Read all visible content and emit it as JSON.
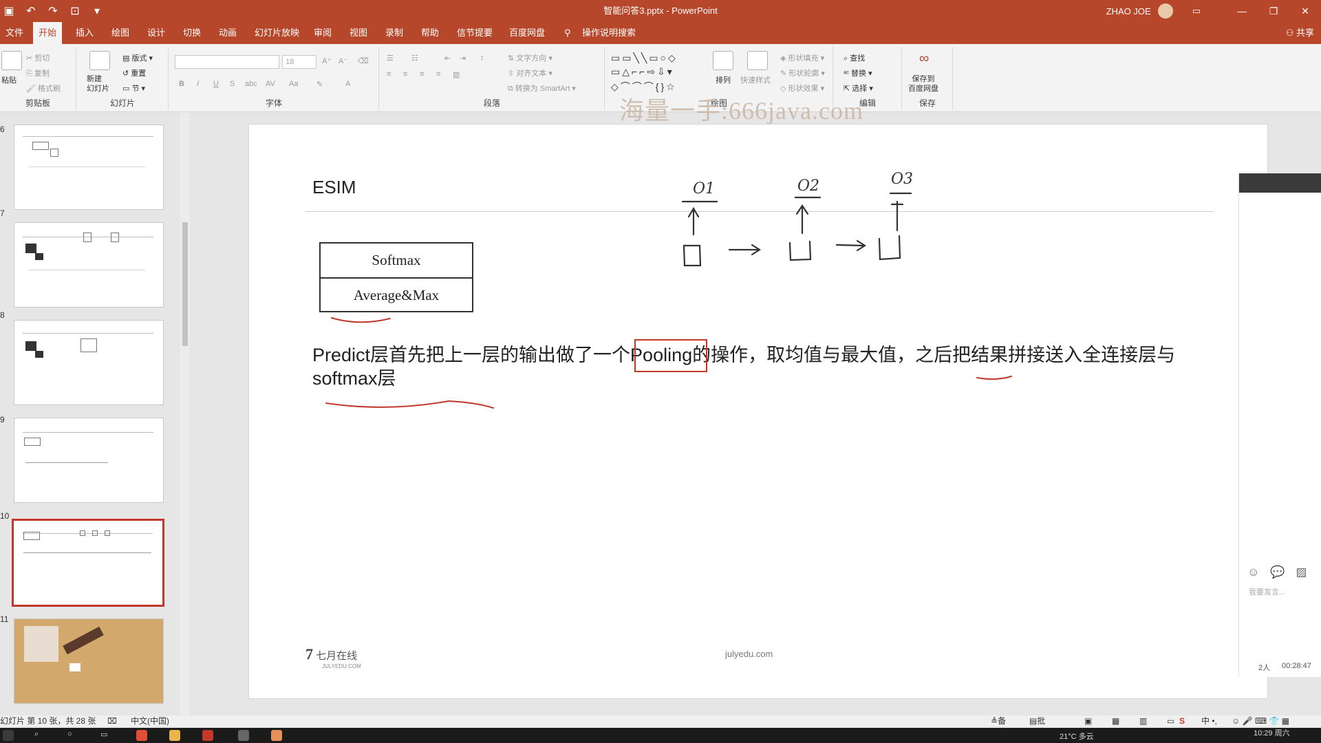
{
  "titlebar": {
    "title": "智能问答3.pptx - PowerPoint",
    "user": "ZHAO JOE"
  },
  "menu": {
    "tabs": [
      "文件",
      "开始",
      "插入",
      "绘图",
      "设计",
      "切换",
      "动画",
      "幻灯片放映",
      "审阅",
      "视图",
      "录制",
      "帮助",
      "信节提要",
      "百度网盘"
    ],
    "search": "操作说明搜索",
    "share": "共享"
  },
  "ribbon": {
    "clipboard": {
      "label": "剪贴板",
      "paste": "粘贴",
      "cut": "剪切",
      "copy": "复制",
      "format": "格式刷"
    },
    "slides": {
      "label": "幻灯片",
      "new": "新建\n幻灯片",
      "layout": "版式",
      "reset": "重置",
      "section": "节"
    },
    "font": {
      "label": "字体",
      "size": "18"
    },
    "paragraph": {
      "label": "段落",
      "text_dir": "文字方向",
      "align_text": "对齐文本",
      "smartart": "转换为 SmartArt"
    },
    "drawing": {
      "label": "绘图",
      "arrange": "排列",
      "quick_styles": "快速样式",
      "fill": "形状填充",
      "outline": "形状轮廓",
      "effects": "形状效果"
    },
    "editing": {
      "label": "编辑",
      "find": "查找",
      "replace": "替换",
      "select": "选择"
    },
    "save": {
      "label": "保存",
      "save_to": "保存到\n百度网盘"
    }
  },
  "watermark": "海量一手:666java.com",
  "thumbnails": {
    "numbers": [
      "6",
      "7",
      "8",
      "9",
      "10",
      "11"
    ],
    "active_index": 4
  },
  "slide": {
    "title": "ESIM",
    "table_rows": [
      "Softmax",
      "Average&Max"
    ],
    "body_before": "Predict层首先把上一层的输出做了一个",
    "body_highlight": "Pooling",
    "body_after": "的操作，取均值与最大值，之后把结果拼接送入全连接层与softmax层",
    "handwriting": [
      "O1",
      "O2",
      "O3"
    ],
    "footer_logo": "七月在线",
    "footer_logo_sub": "JULYEDU.COM",
    "footer_url": "julyedu.com"
  },
  "chat": {
    "input_placeholder": "我要发言...",
    "people": "2人",
    "time": "00:28:47"
  },
  "status": {
    "slide_info": "幻灯片 第 10 张，共 28 张",
    "language": "中文(中国)",
    "notes": "备注",
    "comments": "批注"
  },
  "taskbar": {
    "weather": "21°C 多云",
    "clock": "10:29 周六"
  },
  "colors": {
    "accent": "#b7472a",
    "highlight_red": "#c0392b"
  }
}
